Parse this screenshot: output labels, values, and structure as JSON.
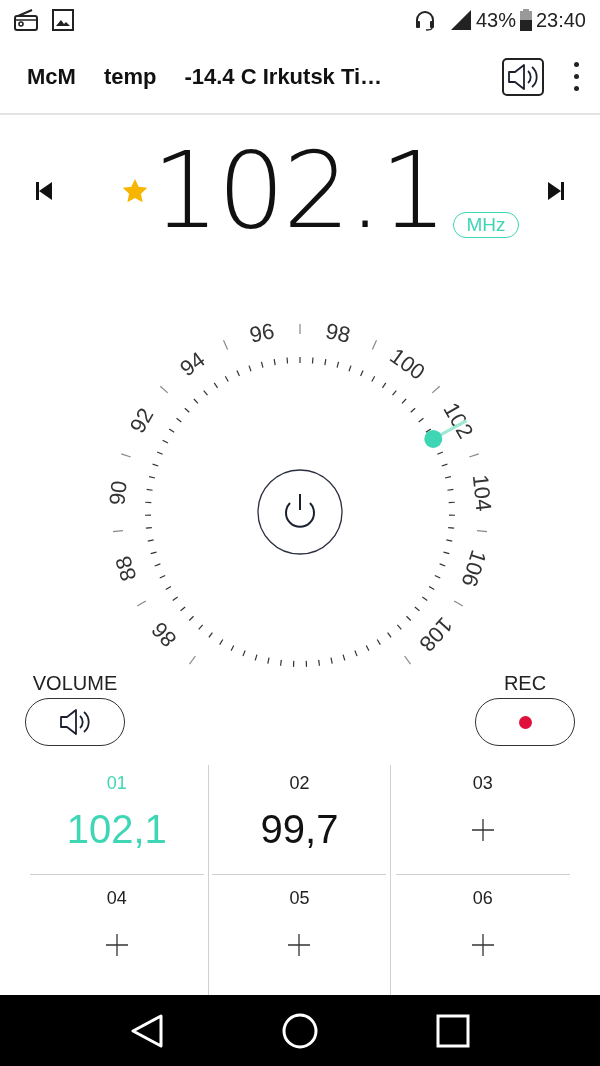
{
  "status_bar": {
    "battery": "43%",
    "time": "23:40"
  },
  "toolbar": {
    "items": [
      "McM",
      "temp",
      "-14.4 C Irkutsk Ti…"
    ]
  },
  "tuner": {
    "frequency": "102.1",
    "unit": "MHz",
    "favorite": true
  },
  "dial": {
    "labels": [
      "86",
      "88",
      "90",
      "92",
      "94",
      "96",
      "98",
      "100",
      "102",
      "104",
      "106",
      "108"
    ]
  },
  "controls": {
    "volume_label": "VOLUME",
    "rec_label": "REC"
  },
  "presets": [
    {
      "number": "01",
      "frequency": "102,1",
      "selected": true
    },
    {
      "number": "02",
      "frequency": "99,7",
      "selected": false
    },
    {
      "number": "03",
      "selected": false
    },
    {
      "number": "04",
      "selected": false
    },
    {
      "number": "05",
      "selected": false
    },
    {
      "number": "06",
      "selected": false
    }
  ]
}
